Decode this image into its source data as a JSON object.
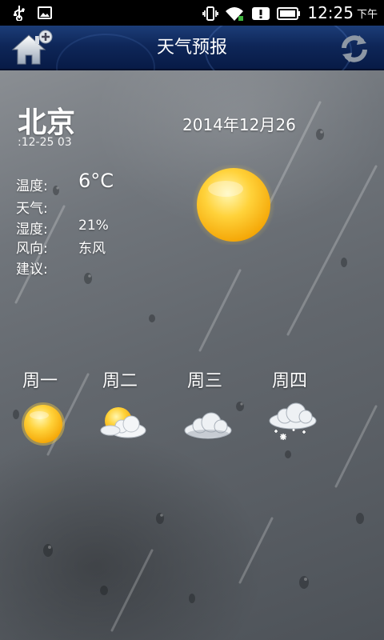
{
  "status_bar": {
    "time": "12:25",
    "ampm": "下午",
    "icons": [
      "usb-icon",
      "image-icon",
      "vibrate-icon",
      "wifi-icon",
      "notice-icon",
      "battery-icon"
    ]
  },
  "header": {
    "title": "天气预报",
    "home_icon": "home-add-icon",
    "refresh_icon": "refresh-icon",
    "bg_color": "#0e2658"
  },
  "current": {
    "city": "北京",
    "date": "2014年12月26",
    "update_time": ":12-25 03",
    "labels": {
      "temperature": "温度:",
      "weather": "天气:",
      "humidity": "湿度:",
      "wind": "风向:",
      "advice": "建议:"
    },
    "values": {
      "temperature": "6°C",
      "weather": "",
      "humidity": "21%",
      "wind": "东风",
      "advice": ""
    },
    "icon": "sun-icon"
  },
  "forecast": [
    {
      "day": "周一",
      "icon": "sun-icon"
    },
    {
      "day": "周二",
      "icon": "partly-cloudy-icon"
    },
    {
      "day": "周三",
      "icon": "cloudy-icon"
    },
    {
      "day": "周四",
      "icon": "snow-icon"
    }
  ]
}
